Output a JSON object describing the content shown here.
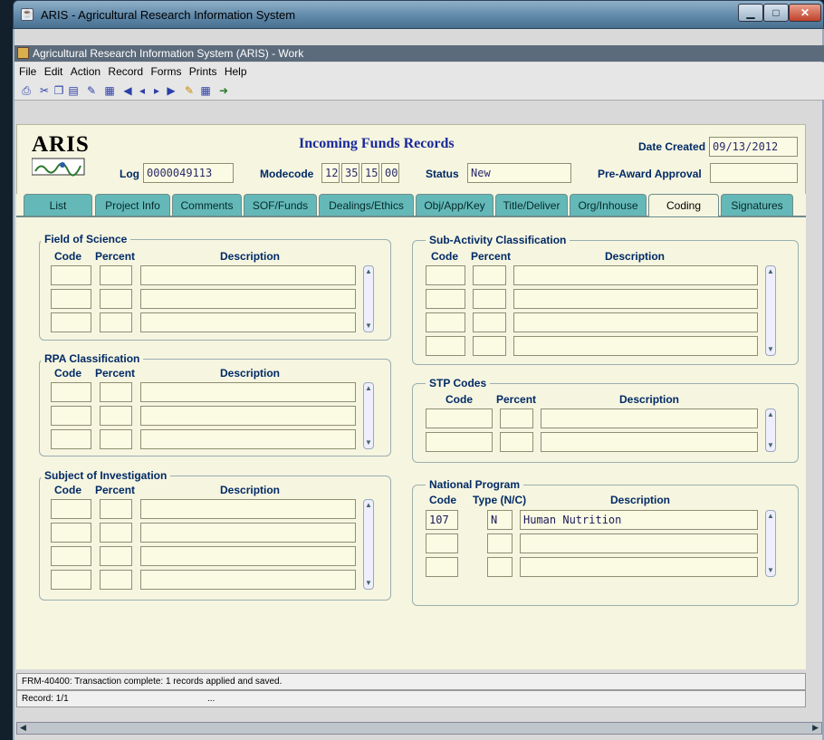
{
  "os_window": {
    "title": "ARIS - Agricultural Research Information System"
  },
  "inner_window": {
    "title": "Agricultural Research Information System (ARIS) - Work"
  },
  "menu": [
    "File",
    "Edit",
    "Action",
    "Record",
    "Forms",
    "Prints",
    "Help"
  ],
  "header": {
    "logo": "ARIS",
    "form_title": "Incoming Funds Records",
    "date_created_label": "Date Created",
    "date_created": "09/13/2012",
    "log_label": "Log",
    "log": "0000049113",
    "modecode_label": "Modecode",
    "modecode": [
      "12",
      "35",
      "15",
      "00"
    ],
    "status_label": "Status",
    "status": "New",
    "pre_award_label": "Pre-Award Approval",
    "pre_award": ""
  },
  "tabs": [
    "List",
    "Project Info",
    "Comments",
    "SOF/Funds",
    "Dealings/Ethics",
    "Obj/App/Key",
    "Title/Deliver",
    "Org/Inhouse",
    "Coding",
    "Signatures"
  ],
  "active_tab": "Coding",
  "groups": {
    "field_of_science": {
      "title": "Field of Science",
      "col_code": "Code",
      "col_percent": "Percent",
      "col_desc": "Description"
    },
    "rpa": {
      "title": "RPA Classification",
      "col_code": "Code",
      "col_percent": "Percent",
      "col_desc": "Description"
    },
    "subject": {
      "title": "Subject of Investigation",
      "col_code": "Code",
      "col_percent": "Percent",
      "col_desc": "Description"
    },
    "sub_activity": {
      "title": "Sub-Activity Classification",
      "col_code": "Code",
      "col_percent": "Percent",
      "col_desc": "Description"
    },
    "stp": {
      "title": "STP Codes",
      "col_code": "Code",
      "col_percent": "Percent",
      "col_desc": "Description"
    },
    "national_program": {
      "title": "National Program",
      "col_code": "Code",
      "col_type": "Type (N/C)",
      "col_desc": "Description",
      "rows": [
        {
          "code": "107",
          "type": "N",
          "desc": "Human Nutrition"
        },
        {
          "code": "",
          "type": "",
          "desc": ""
        },
        {
          "code": "",
          "type": "",
          "desc": ""
        }
      ]
    }
  },
  "status_bar": {
    "message": "FRM-40400: Transaction complete: 1 records applied and saved.",
    "record": "Record: 1/1",
    "ellipsis": "..."
  },
  "colors": {
    "tab": "#64b8b8",
    "form_bg": "#f6f5e0",
    "label": "#002a66"
  }
}
